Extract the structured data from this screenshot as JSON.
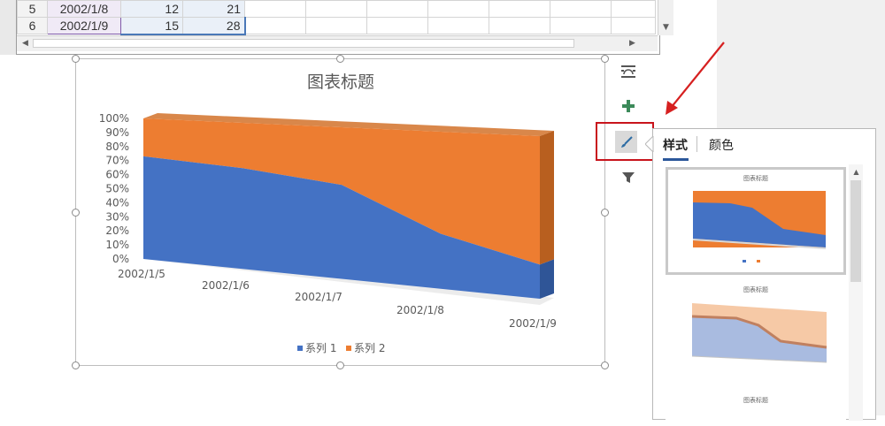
{
  "sheet": {
    "rows": [
      {
        "num": "5",
        "date": "2002/1/8",
        "s1": "12",
        "s2": "21"
      },
      {
        "num": "6",
        "date": "2002/1/9",
        "s1": "15",
        "s2": "28"
      }
    ]
  },
  "chart": {
    "title": "图表标题",
    "legend": [
      "系列 1",
      "系列 2"
    ]
  },
  "chart_data": {
    "type": "area",
    "subtype": "3d-100%-stacked",
    "title": "图表标题",
    "categories": [
      "2002/1/5",
      "2002/1/6",
      "2002/1/7",
      "2002/1/8",
      "2002/1/9"
    ],
    "series": [
      {
        "name": "系列 1",
        "color": "#4472c4",
        "values": [
          73,
          69,
          62,
          35,
          21
        ]
      },
      {
        "name": "系列 2",
        "color": "#ed7d31",
        "values": [
          27,
          31,
          38,
          65,
          79
        ]
      }
    ],
    "y_ticks": [
      "0%",
      "10%",
      "20%",
      "30%",
      "40%",
      "50%",
      "60%",
      "70%",
      "80%",
      "90%",
      "100%"
    ],
    "ylim": [
      0,
      100
    ],
    "legend_position": "bottom"
  },
  "panel": {
    "tabs": [
      "样式",
      "颜色"
    ],
    "active_tab": "样式",
    "thumb_titles": [
      "图表标题",
      "图表标题",
      "图表标题"
    ]
  },
  "toolbar": {
    "buttons": [
      "layout-options-icon",
      "chart-elements-icon",
      "chart-styles-icon",
      "chart-filters-icon"
    ]
  },
  "colors": {
    "accent": "#c8141c",
    "series1": "#4472c4",
    "series2": "#ed7d31"
  }
}
